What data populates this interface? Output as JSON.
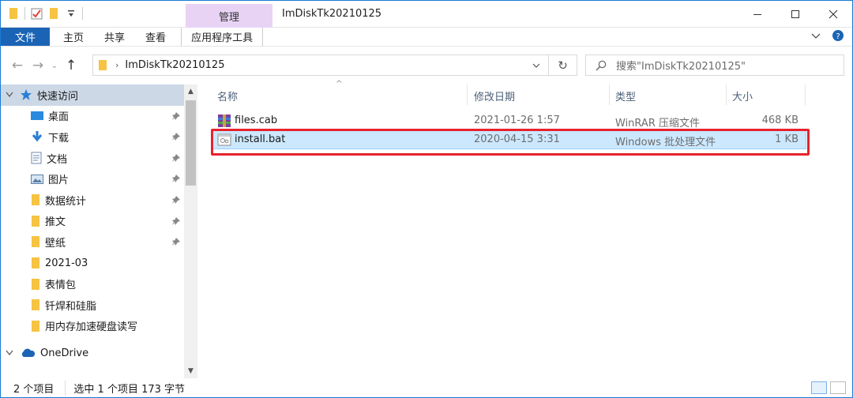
{
  "title_bar": {
    "context_tab": "管理",
    "window_title": "ImDiskTk20210125",
    "controls": [
      "minimize-icon",
      "maximize-icon",
      "close-icon"
    ]
  },
  "ribbon": {
    "tabs": [
      "文件",
      "主页",
      "共享",
      "查看"
    ],
    "app_tools_tab": "应用程序工具"
  },
  "address_bar": {
    "crumb": "ImDiskTk20210125",
    "search_placeholder": "搜索\"ImDiskTk20210125\""
  },
  "navigation": {
    "quick_access": "快速访问",
    "items": [
      {
        "label": "桌面",
        "icon": "desktop-icon",
        "pinned": true
      },
      {
        "label": "下载",
        "icon": "download-icon",
        "pinned": true
      },
      {
        "label": "文档",
        "icon": "document-icon",
        "pinned": true
      },
      {
        "label": "图片",
        "icon": "picture-icon",
        "pinned": true
      },
      {
        "label": "数据统计",
        "icon": "folder-icon",
        "pinned": true
      },
      {
        "label": "推文",
        "icon": "folder-icon",
        "pinned": true
      },
      {
        "label": "壁纸",
        "icon": "folder-icon",
        "pinned": true
      },
      {
        "label": "2021-03",
        "icon": "folder-icon",
        "pinned": false
      },
      {
        "label": "表情包",
        "icon": "folder-icon",
        "pinned": false
      },
      {
        "label": "钎焊和硅脂",
        "icon": "folder-icon",
        "pinned": false
      },
      {
        "label": "用内存加速硬盘读写",
        "icon": "folder-icon",
        "pinned": false
      }
    ],
    "onedrive": "OneDrive"
  },
  "file_list": {
    "columns": [
      "名称",
      "修改日期",
      "类型",
      "大小"
    ],
    "rows": [
      {
        "name": "files.cab",
        "date": "2021-01-26 1:57",
        "type": "WinRAR 压缩文件",
        "size": "468 KB",
        "icon": "archive-icon",
        "selected": false
      },
      {
        "name": "install.bat",
        "date": "2020-04-15 3:31",
        "type": "Windows 批处理文件",
        "size": "1 KB",
        "icon": "batch-file-icon",
        "selected": true
      }
    ]
  },
  "status_bar": {
    "count": "2 个项目",
    "selection": "选中 1 个项目  173 字节"
  },
  "colors": {
    "file_tab": "#1b64b5",
    "context_tab": "#e8d3f5",
    "selection": "#cce8ff",
    "highlight_box": "#e8222e",
    "folder": "#f6c342"
  }
}
